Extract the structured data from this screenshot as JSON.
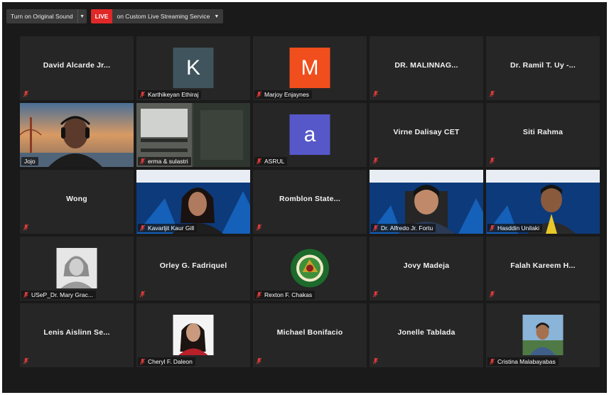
{
  "toolbar": {
    "original_sound": "Turn on Original Sound",
    "live_badge": "LIVE",
    "stream_label": "on Custom Live Streaming Service"
  },
  "colors": {
    "background": "#1a1a1a",
    "tile": "#262626",
    "active_border": "#d4e157",
    "live": "#e02828",
    "muted_icon": "#e03b3b"
  },
  "participants": [
    {
      "name": "David Alcarde Jr...",
      "display": "name",
      "muted": true
    },
    {
      "name": "Karthikeyan Ethiraj",
      "display": "avatar",
      "initial": "K",
      "avatar_color": "#3f545d",
      "muted": true
    },
    {
      "name": "Marjoy Enjaynes",
      "display": "avatar",
      "initial": "M",
      "avatar_color": "#f04e1c",
      "muted": true
    },
    {
      "name": "DR. MALINNAG...",
      "display": "name",
      "muted": true
    },
    {
      "name": "Dr. Ramil T. Uy -...",
      "display": "name",
      "muted": true
    },
    {
      "name": "Jojo",
      "display": "video",
      "muted": false,
      "active": true
    },
    {
      "name": "erma & sulastri",
      "display": "video",
      "muted": true
    },
    {
      "name": "ASRUL",
      "display": "avatar",
      "initial": "a",
      "avatar_color": "#5657c9",
      "muted": true
    },
    {
      "name": "Virne Dalisay CET",
      "display": "name",
      "muted": true
    },
    {
      "name": "Siti Rahma",
      "display": "name",
      "muted": true
    },
    {
      "name": "Wong",
      "display": "name",
      "muted": true
    },
    {
      "name": "Kavarljit Kaur Gill",
      "display": "video",
      "muted": true
    },
    {
      "name": "Romblon State...",
      "display": "name",
      "muted": true
    },
    {
      "name": "Dr. Alfredo Jr. Fortu",
      "display": "video",
      "muted": true
    },
    {
      "name": "Hasddin Unilaki",
      "display": "video",
      "muted": true
    },
    {
      "name": "USeP_Dr. Mary Grac...",
      "display": "photo",
      "muted": true
    },
    {
      "name": "Orley G. Fadriquel",
      "display": "name",
      "muted": true
    },
    {
      "name": "Rexton F. Chakas",
      "display": "photo",
      "muted": true
    },
    {
      "name": "Jovy Madeja",
      "display": "name",
      "muted": true
    },
    {
      "name": "Falah Kareem H...",
      "display": "name",
      "muted": true
    },
    {
      "name": "Lenis Aislinn Se...",
      "display": "name",
      "muted": true
    },
    {
      "name": "Cheryl F. Daleon",
      "display": "photo",
      "muted": true
    },
    {
      "name": "Michael Bonifacio",
      "display": "name",
      "muted": true
    },
    {
      "name": "Jonelle Tablada",
      "display": "name",
      "muted": true
    },
    {
      "name": "Cristina Malabayabas",
      "display": "photo",
      "muted": true
    }
  ]
}
